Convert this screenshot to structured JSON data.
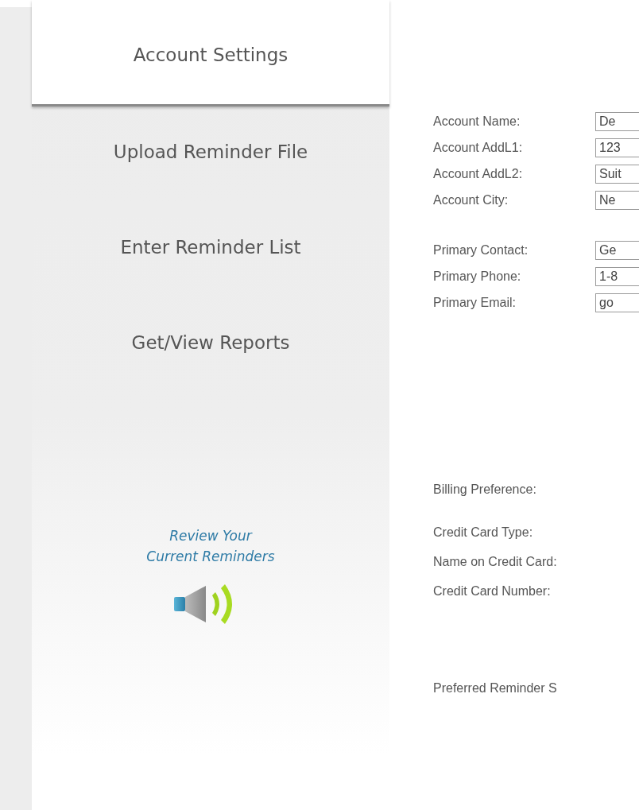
{
  "sidebar": {
    "items": [
      {
        "label": "Account Settings",
        "selected": true
      },
      {
        "label": "Upload Reminder File",
        "selected": false
      },
      {
        "label": "Enter Reminder List",
        "selected": false
      },
      {
        "label": "Get/View Reports",
        "selected": false
      }
    ],
    "promo": {
      "lines": [
        "Review Your",
        "Current Reminders"
      ]
    }
  },
  "form": {
    "sections": [
      {
        "fields": [
          {
            "label": "Account Name:",
            "value": "De"
          },
          {
            "label": "Account AddL1:",
            "value": "123"
          },
          {
            "label": "Account AddL2:",
            "value": "Suit"
          },
          {
            "label": "Account City:",
            "value": "Ne"
          }
        ]
      },
      {
        "fields": [
          {
            "label": "Primary Contact:",
            "value": "Ge"
          },
          {
            "label": "Primary Phone:",
            "value": "1-8"
          },
          {
            "label": "Primary Email:",
            "value": "go"
          }
        ]
      },
      {
        "fields": [
          {
            "label": "Billing Preference:"
          }
        ]
      },
      {
        "fields": [
          {
            "label": "Credit Card Type:"
          },
          {
            "label": "Name on Credit Card:"
          },
          {
            "label": "Credit Card Number:"
          }
        ]
      },
      {
        "fields": [
          {
            "label": "Preferred Reminder S"
          }
        ]
      }
    ]
  }
}
